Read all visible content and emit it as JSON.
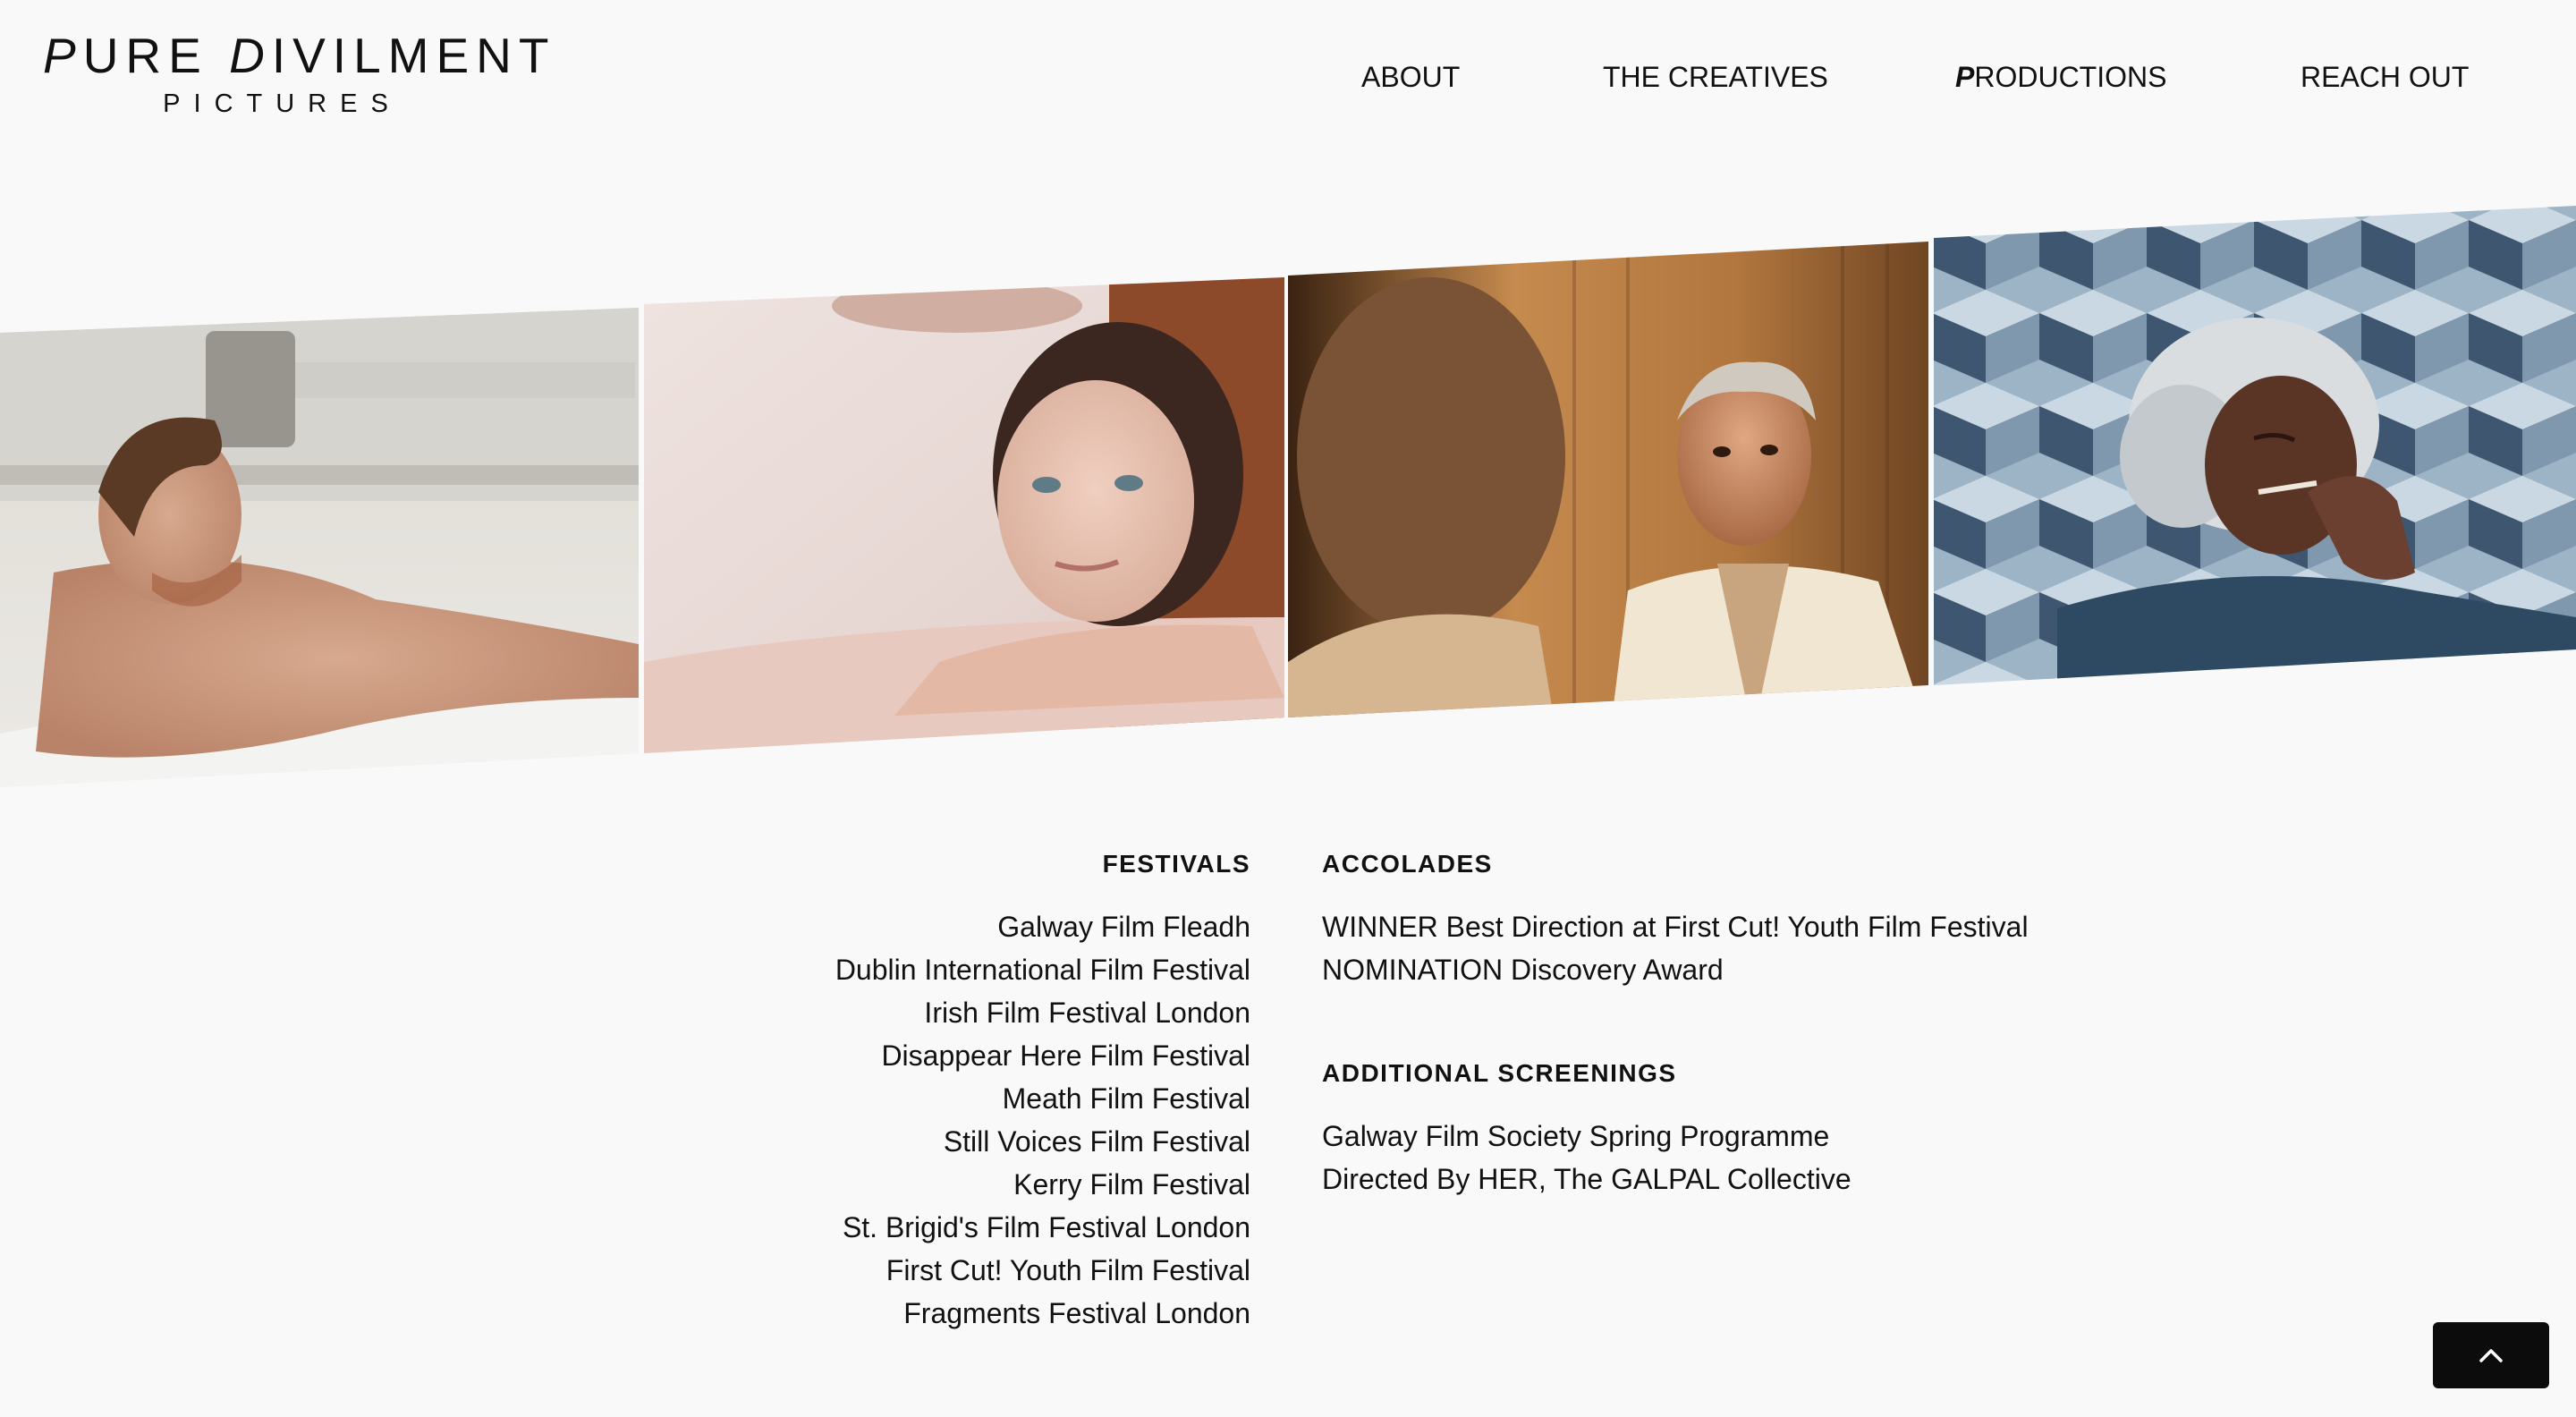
{
  "header": {
    "logo": {
      "title_first_p": "P",
      "title_rest_1": "URE ",
      "title_first_d": "D",
      "title_rest_2": "IVILMENT",
      "subtitle": "PICTURES"
    },
    "nav": {
      "about": "ABOUT",
      "creatives": "THE CREATIVES",
      "productions_first": "P",
      "productions_rest": "RODUCTIONS",
      "reach_out": "REACH OUT"
    }
  },
  "gallery": {
    "frames": [
      {
        "subject": "man-in-bathtub"
      },
      {
        "subject": "woman-in-bath"
      },
      {
        "subject": "older-man-in-robe"
      },
      {
        "subject": "woman-smoking-on-tiles"
      }
    ]
  },
  "festivals": {
    "heading": "FESTIVALS",
    "items": [
      "Galway Film Fleadh",
      "Dublin International Film Festival",
      "Irish Film Festival London",
      "Disappear Here Film Festival",
      "Meath Film Festival",
      "Still Voices Film Festival",
      "Kerry Film Festival",
      "St. Brigid's Film Festival London",
      "First Cut! Youth Film Festival",
      "Fragments Festival London"
    ]
  },
  "accolades": {
    "heading": "ACCOLADES",
    "items": [
      "WINNER Best Direction at First Cut! Youth Film Festival",
      "NOMINATION Discovery Award"
    ]
  },
  "screenings": {
    "heading": "ADDITIONAL SCREENINGS",
    "items": [
      "Galway Film Society Spring Programme",
      "Directed By HER, The GALPAL Collective"
    ]
  },
  "back_to_top": {
    "icon": "chevron-up-icon",
    "color": "#0c0c0c"
  },
  "colors": {
    "background": "#f9f9f9",
    "text": "#111111"
  }
}
